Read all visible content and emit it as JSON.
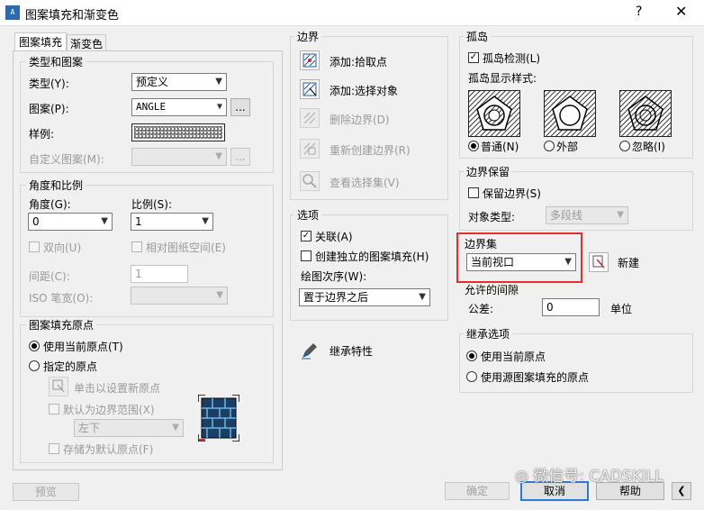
{
  "window": {
    "title": "图案填充和渐变色",
    "help": "?",
    "close": "✕"
  },
  "tabs": [
    {
      "label": "图案填充"
    },
    {
      "label": "渐变色"
    }
  ],
  "type_pattern": {
    "title": "类型和图案",
    "type_label": "类型(Y):",
    "type_value": "预定义",
    "pattern_label": "图案(P):",
    "pattern_value": "ANGLE",
    "browse": "...",
    "swatch_label": "样例:",
    "custom_label": "自定义图案(M):",
    "custom_value": ""
  },
  "angle_scale": {
    "title": "角度和比例",
    "angle_label": "角度(G):",
    "angle_value": "0",
    "scale_label": "比例(S):",
    "scale_value": "1",
    "double_label": "双向(U)",
    "relative_label": "相对图纸空间(E)",
    "spacing_label": "间距(C):",
    "spacing_value": "1",
    "iso_label": "ISO 笔宽(O):"
  },
  "origin": {
    "title": "图案填充原点",
    "current_label": "使用当前原点(T)",
    "specified_label": "指定的原点",
    "click_label": "单击以设置新原点",
    "default_label": "默认为边界范围(X)",
    "position_value": "左下",
    "store_label": "存储为默认原点(F)"
  },
  "boundaries": {
    "title": "边界",
    "pick_label": "添加:拾取点",
    "select_label": "添加:选择对象",
    "remove_label": "删除边界(D)",
    "recreate_label": "重新创建边界(R)",
    "view_label": "查看选择集(V)"
  },
  "options": {
    "title": "选项",
    "assoc_label": "关联(A)",
    "separate_label": "创建独立的图案填充(H)",
    "draworder_label": "绘图次序(W):",
    "draworder_value": "置于边界之后"
  },
  "inherit": {
    "label": "继承特性"
  },
  "islands": {
    "title": "孤岛",
    "detect_label": "孤岛检测(L)",
    "style_label": "孤岛显示样式:",
    "normal_label": "普通(N)",
    "outer_label": "外部",
    "ignore_label": "忽略(I)"
  },
  "retain": {
    "title": "边界保留",
    "retain_label": "保留边界(S)",
    "objtype_label": "对象类型:",
    "objtype_value": "多段线"
  },
  "boundary_set": {
    "title": "边界集",
    "value": "当前视口",
    "new_label": "新建"
  },
  "gap": {
    "title": "允许的间隙",
    "tol_label": "公差:",
    "tol_value": "0",
    "unit_label": "单位"
  },
  "inherit_opts": {
    "title": "继承选项",
    "current_label": "使用当前原点",
    "source_label": "使用源图案填充的原点"
  },
  "footer": {
    "preview": "预览",
    "ok": "确定",
    "cancel": "取消",
    "help": "帮助"
  },
  "watermark": "微信号: CADSKILL",
  "colors": {
    "highlight": "#e03030",
    "accent": "#2a7bd8"
  }
}
